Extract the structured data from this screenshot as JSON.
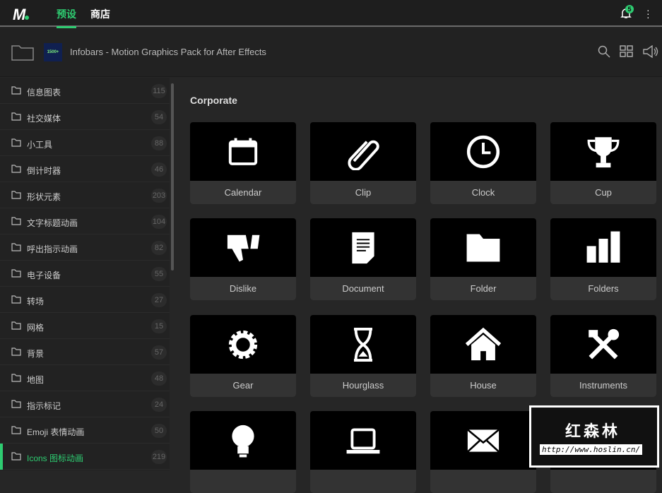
{
  "topbar": {
    "logo": "M",
    "tabs": [
      "预设",
      "商店"
    ],
    "notifications": "5"
  },
  "header": {
    "thumbnail_text": "1500+",
    "title": "Infobars - Motion Graphics Pack for After Effects"
  },
  "sidebar": {
    "items": [
      {
        "label": "信息图表",
        "count": "115"
      },
      {
        "label": "社交媒体",
        "count": "54"
      },
      {
        "label": "小工具",
        "count": "88"
      },
      {
        "label": "倒计时器",
        "count": "46"
      },
      {
        "label": "形状元素",
        "count": "203"
      },
      {
        "label": "文字标题动画",
        "count": "104"
      },
      {
        "label": "呼出指示动画",
        "count": "82"
      },
      {
        "label": "电子设备",
        "count": "55"
      },
      {
        "label": "转场",
        "count": "27"
      },
      {
        "label": "网格",
        "count": "15"
      },
      {
        "label": "背景",
        "count": "57"
      },
      {
        "label": "地图",
        "count": "48"
      },
      {
        "label": "指示标记",
        "count": "24"
      },
      {
        "label": "Emoji 表情动画",
        "count": "50"
      },
      {
        "label": "Icons 图标动画",
        "count": "219",
        "active": true
      }
    ]
  },
  "main": {
    "section": "Corporate",
    "cards": [
      {
        "label": "Calendar",
        "icon": "calendar-icon"
      },
      {
        "label": "Clip",
        "icon": "paperclip-icon"
      },
      {
        "label": "Clock",
        "icon": "clock-icon"
      },
      {
        "label": "Cup",
        "icon": "trophy-icon"
      },
      {
        "label": "Dislike",
        "icon": "thumbs-down-icon"
      },
      {
        "label": "Document",
        "icon": "document-icon"
      },
      {
        "label": "Folder",
        "icon": "folder-icon"
      },
      {
        "label": "Folders",
        "icon": "bar-folders-icon"
      },
      {
        "label": "Gear",
        "icon": "gear-icon"
      },
      {
        "label": "Hourglass",
        "icon": "hourglass-icon"
      },
      {
        "label": "House",
        "icon": "house-icon"
      },
      {
        "label": "Instruments",
        "icon": "tools-icon"
      },
      {
        "label": "",
        "icon": "lightbulb-icon"
      },
      {
        "label": "",
        "icon": "laptop-icon"
      },
      {
        "label": "",
        "icon": "envelope-icon"
      },
      {
        "label": "",
        "icon": "unknown-icon"
      }
    ]
  },
  "watermark": {
    "title": "红森林",
    "url": "http://www.hoslin.cn/"
  },
  "colors": {
    "accent": "#2ecc71",
    "background": "#262626"
  }
}
